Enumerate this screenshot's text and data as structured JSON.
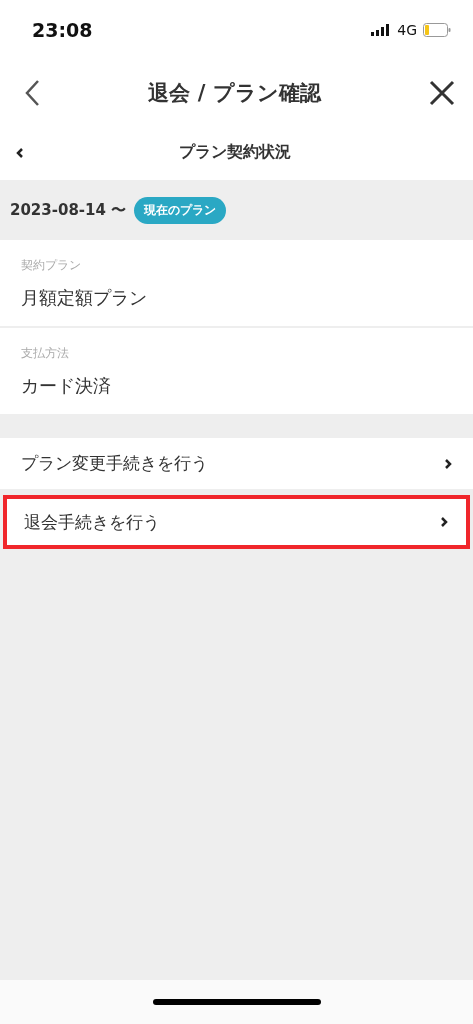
{
  "status_bar": {
    "time": "23:08",
    "network": "4G"
  },
  "nav_bar": {
    "title": "退会 / プラン確認"
  },
  "sub_header": {
    "title": "プラン契約状況"
  },
  "period": {
    "date": "2023-08-14 〜",
    "badge": "現在のプラン"
  },
  "fields": [
    {
      "label": "契約プラン",
      "value": "月額定額プラン"
    },
    {
      "label": "支払方法",
      "value": "カード決済"
    }
  ],
  "actions": [
    {
      "label": "プラン変更手続きを行う",
      "highlighted": false
    },
    {
      "label": "退会手続きを行う",
      "highlighted": true
    }
  ]
}
